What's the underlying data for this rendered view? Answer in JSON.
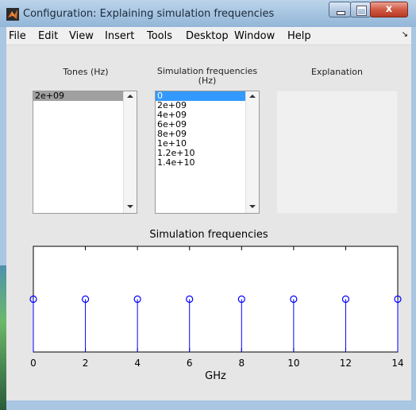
{
  "window": {
    "title": "Configuration: Explaining simulation frequencies",
    "close_glyph": "x"
  },
  "menu": [
    "File",
    "Edit",
    "View",
    "Insert",
    "Tools",
    "Desktop",
    "Window",
    "Help"
  ],
  "panels": {
    "tones": {
      "label": "Tones (Hz)",
      "items": [
        "2e+09"
      ],
      "selected_index": 0
    },
    "simfreq": {
      "label_line1": "Simulation frequencies",
      "label_line2": "(Hz)",
      "items": [
        "0",
        "2e+09",
        "4e+09",
        "6e+09",
        "8e+09",
        "1e+10",
        "1.2e+10",
        "1.4e+10"
      ],
      "selected_index": 0
    },
    "explanation": {
      "label": "Explanation"
    }
  },
  "icons": {
    "app": "matlab-icon",
    "minimize": "minimize-icon",
    "maximize": "maximize-icon",
    "close": "close-icon",
    "menu_overflow": "chevron-right-icon",
    "scroll_up": "scroll-up-arrow-icon",
    "scroll_down": "scroll-down-arrow-icon"
  },
  "colors": {
    "stem": "#0000ff",
    "selection": "#3399ff"
  },
  "chart_data": {
    "type": "stem",
    "title": "Simulation frequencies",
    "xlabel": "GHz",
    "ylabel": "",
    "x": [
      0,
      2,
      4,
      6,
      8,
      10,
      12,
      14
    ],
    "y": [
      1,
      1,
      1,
      1,
      1,
      1,
      1,
      1
    ],
    "xlim": [
      0,
      14
    ],
    "ylim": [
      0,
      2
    ],
    "xticks": [
      "0",
      "2",
      "4",
      "6",
      "8",
      "10",
      "12",
      "14"
    ],
    "grid": false,
    "legend": "none",
    "marker": "o"
  }
}
